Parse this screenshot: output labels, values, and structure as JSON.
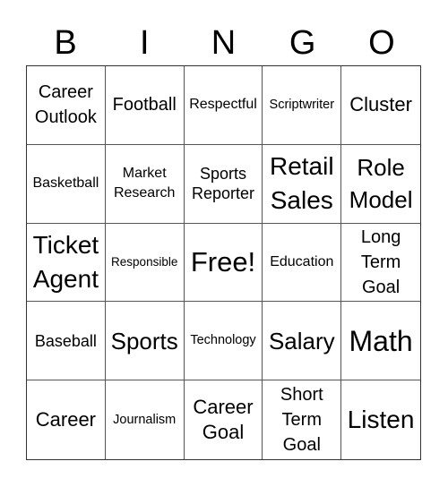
{
  "title_letters": [
    "B",
    "I",
    "N",
    "G",
    "O"
  ],
  "cells": [
    {
      "text": "Career\nOutlook",
      "size": "s20"
    },
    {
      "text": "Football",
      "size": "s20"
    },
    {
      "text": "Respectful",
      "size": "s16"
    },
    {
      "text": "Scriptwriter",
      "size": "s14"
    },
    {
      "text": "Cluster",
      "size": "s22"
    },
    {
      "text": "Basketball",
      "size": "s16"
    },
    {
      "text": "Market\nResearch",
      "size": "s16"
    },
    {
      "text": "Sports\nReporter",
      "size": "s18"
    },
    {
      "text": "Retail\nSales",
      "size": "s28"
    },
    {
      "text": "Role\nModel",
      "size": "s26"
    },
    {
      "text": "Ticket\nAgent",
      "size": "s28"
    },
    {
      "text": "Responsible",
      "size": "s13"
    },
    {
      "text": "Free!",
      "size": "s31"
    },
    {
      "text": "Education",
      "size": "s16"
    },
    {
      "text": "Long\nTerm\nGoal",
      "size": "s20"
    },
    {
      "text": "Baseball",
      "size": "s18"
    },
    {
      "text": "Sports",
      "size": "s26"
    },
    {
      "text": "Technology",
      "size": "s14"
    },
    {
      "text": "Salary",
      "size": "s26"
    },
    {
      "text": "Math",
      "size": "s32"
    },
    {
      "text": "Career",
      "size": "s22"
    },
    {
      "text": "Journalism",
      "size": "s14"
    },
    {
      "text": "Career\nGoal",
      "size": "s22"
    },
    {
      "text": "Short\nTerm\nGoal",
      "size": "s20"
    },
    {
      "text": "Listen",
      "size": "s28"
    }
  ]
}
